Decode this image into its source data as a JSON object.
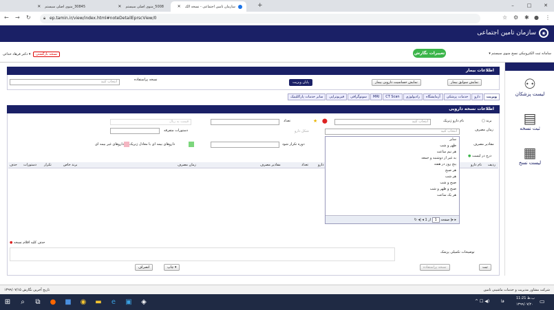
{
  "browser": {
    "tabs": [
      {
        "title": "سازمان تامین اجتماعی - نسخه الک"
      },
      {
        "title": "5008_منوی اصلی سیستم"
      },
      {
        "title": "30845_منوی اصلی سیستم"
      }
    ],
    "new_tab": "+",
    "url": "ep.tamin.ir/view/index.html#noteDetailEprscView/0",
    "window_controls": [
      "–",
      "□",
      "✕"
    ]
  },
  "header": {
    "logo_text": "سازمان تامین اجتماعی",
    "logo_icon": "tamin-logo-icon"
  },
  "subbar": {
    "right_menu": "سامانه ثبت الکترونیکی نسخ   منوی سیستم ▾",
    "green_button": "تغییرات نگارش",
    "user": "دکتر فرهاد خدائی ▾",
    "red_tag": "نسخه بازگشتی"
  },
  "sidebar": {
    "items": [
      {
        "label": "لیست پزشکان",
        "icon": "doctors-icon"
      },
      {
        "label": "ثبت نسخه",
        "icon": "prescription-icon"
      },
      {
        "label": "لیست نسخ",
        "icon": "list-icon"
      }
    ]
  },
  "patient": {
    "title": "اطلاعات بیمار",
    "btn_history": "نمایش سوابق بیمار",
    "btn_allergy": "نمایش حساسیت دارویی بیمار",
    "btn_end_visit": "پایان ویزیت",
    "usage_label": "نسخه پراستفاده",
    "select_placeholder": "انتخاب کنید"
  },
  "tabs": [
    "ویزیت",
    "دارو",
    "خدمات پزشکی",
    "آزمایشگاه",
    "رادیولوژی",
    "CT Scan",
    "MRI",
    "سونوگرافی",
    "فیزیوتراپی",
    "سایر خدمات پاراکلینیک"
  ],
  "drug_form": {
    "title": "اطلاعات نسخه دارویی",
    "brand_label": "برند",
    "generic_label": "نام دارو ژنریک",
    "generic_placeholder": "انتخاب کنید",
    "count_label": "تعداد",
    "price_placeholder": "قیمت به ریال",
    "time_label": "زمان مصرف",
    "time_placeholder": "انتخاب کنید",
    "shape_label": "شکل دارو",
    "instructions_label": "دستورات متفرقه",
    "amount_label": "مقادیر مصرف",
    "repeat_label": "دوره تکرار شود",
    "legend_green": "داروهای بیمه ای با معادل ژنریک",
    "legend_pink": "داروهای غیر بیمه ای",
    "add_button": "درج در لیست",
    "delete_all": "حذف کلیه اقلام نسخه"
  },
  "grid": {
    "headers_right": [
      "ردیف",
      "نام دارو"
    ],
    "headers_mid": [
      "دارو",
      "تعداد",
      "مقادیر مصرف",
      "زمان مصرف"
    ],
    "headers_left": [
      "برند خاص",
      "تکرار",
      "دستورات",
      "حذف"
    ]
  },
  "dropdown": {
    "options": [
      "سایر",
      "ظهر و شب",
      "هر نیم ساعت",
      "به غیر از دوشنبه و جمعه",
      "پنج روز در هفته",
      "هر صبح",
      "هر شب",
      "صبح و شب",
      "صبح و ظهر و شب",
      "هر یک ساعت"
    ],
    "pager_page_label": "صفحه",
    "pager_page": "1",
    "pager_of": "از 1"
  },
  "footer": {
    "notes_label": "توضیحات تکمیلی پزشک",
    "btn_save": "ثبت",
    "btn_used": "نسخه پراستفاده",
    "btn_print": "چاپ ▾",
    "btn_cancel": "انصراف",
    "status_right": "شرکت مشاور مدیریت و خدمات ماشینی تامین",
    "status_left": "تاریخ آخرین نگارش ۱۳۹۹/۰۷/۱۵"
  },
  "taskbar": {
    "time": "11:21 ب.ظ",
    "date": "۱۳۹۹/۰۷/۲۰",
    "lang": "فا"
  },
  "colors": {
    "navy": "#1a2066",
    "green": "#3bb54a",
    "red": "#dd0000"
  }
}
